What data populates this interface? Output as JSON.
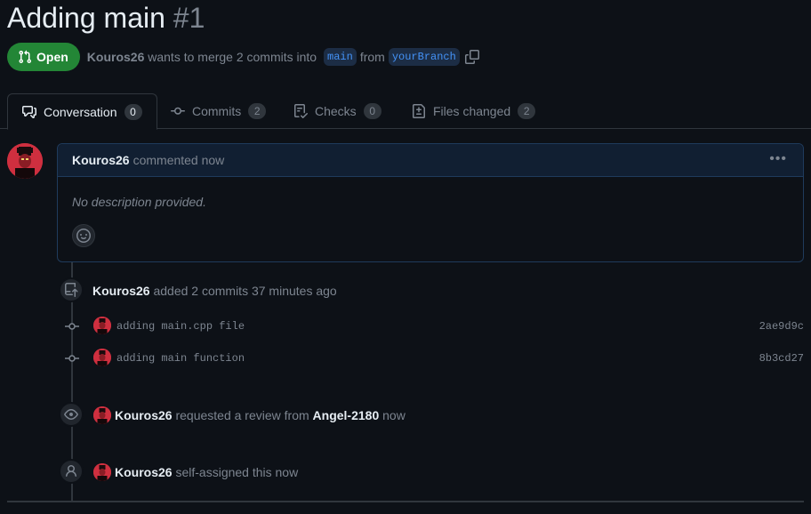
{
  "pr": {
    "title": "Adding main",
    "number": "#1",
    "state": "Open",
    "author": "Kouros26",
    "merge_text": "wants to merge 2 commits into",
    "base_branch": "main",
    "from_word": "from",
    "head_branch": "yourBranch"
  },
  "tabs": [
    {
      "label": "Conversation",
      "count": "0",
      "selected": true,
      "icon": "conversation-icon"
    },
    {
      "label": "Commits",
      "count": "2",
      "selected": false,
      "icon": "commit-icon"
    },
    {
      "label": "Checks",
      "count": "0",
      "selected": false,
      "icon": "checklist-icon"
    },
    {
      "label": "Files changed",
      "count": "2",
      "selected": false,
      "icon": "file-diff-icon"
    }
  ],
  "comment": {
    "author": "Kouros26",
    "meta": "commented now",
    "body": "No description provided."
  },
  "timeline": {
    "commits_event": {
      "author": "Kouros26",
      "text": "added 2 commits 37 minutes ago"
    },
    "commits": [
      {
        "message": "adding main.cpp file",
        "sha": "2ae9d9c"
      },
      {
        "message": "adding main function",
        "sha": "8b3cd27"
      }
    ],
    "review_event": {
      "author": "Kouros26",
      "text": "requested a review from",
      "reviewer": "Angel-2180",
      "time": "now"
    },
    "assign_event": {
      "author": "Kouros26",
      "text": "self-assigned this now"
    }
  },
  "colors": {
    "background": "#0d1117",
    "open_green": "#238636",
    "branch_blue": "#4493f8",
    "muted": "#7d8590"
  }
}
